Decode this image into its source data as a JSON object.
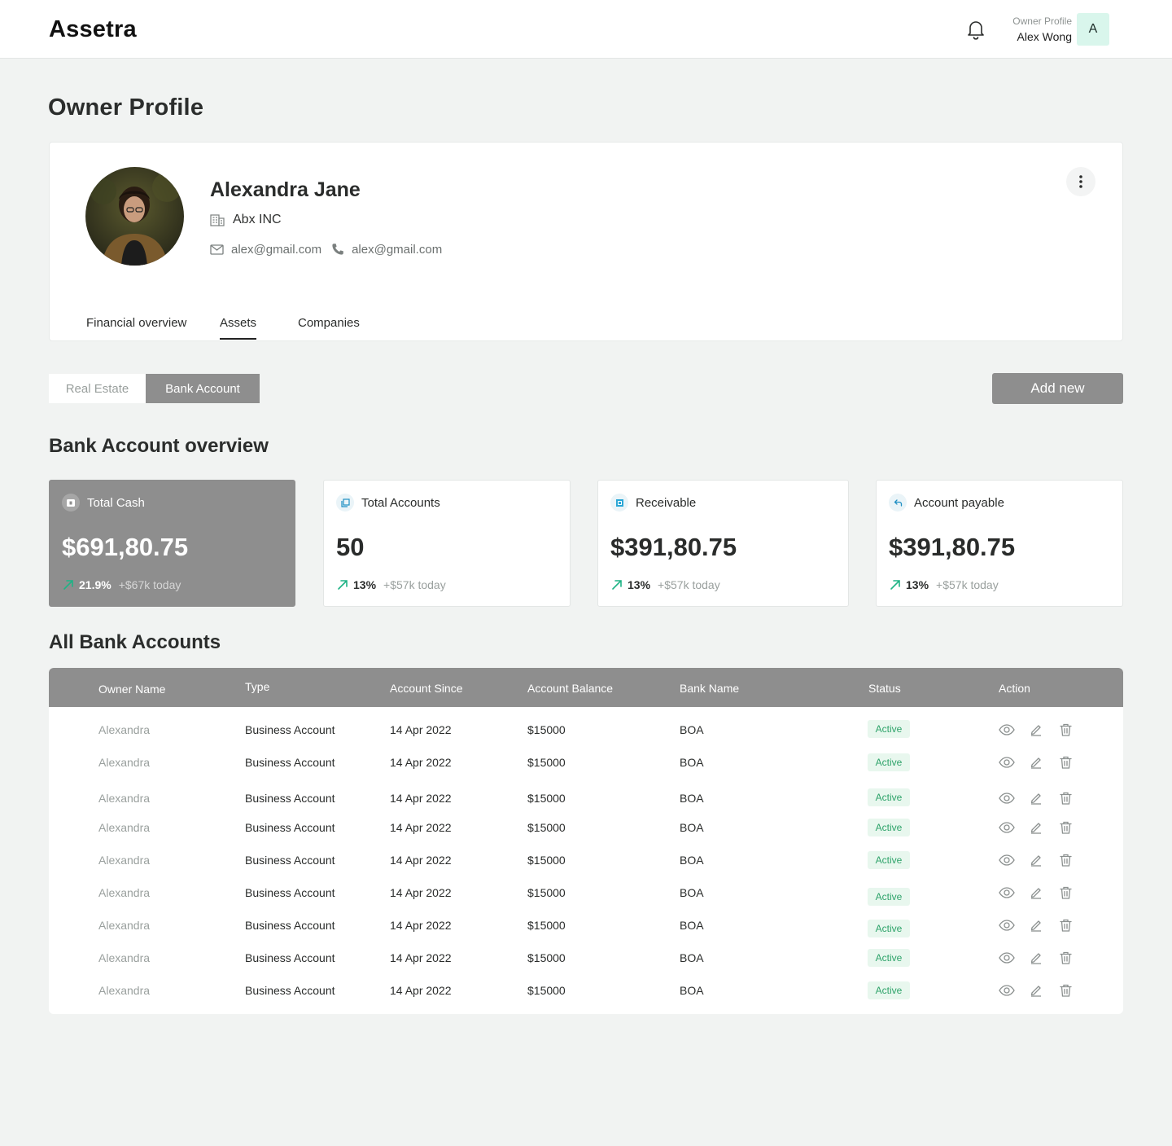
{
  "app": {
    "brand": "Assetra"
  },
  "header": {
    "user_role": "Owner Profile",
    "user_name": "Alex Wong",
    "avatar_initial": "A"
  },
  "page": {
    "title": "Owner Profile"
  },
  "profile": {
    "name": "Alexandra Jane",
    "company": "Abx INC",
    "email": "alex@gmail.com",
    "phone": "alex@gmail.com",
    "tabs": [
      {
        "label": "Financial overview"
      },
      {
        "label": "Assets"
      },
      {
        "label": "Companies"
      }
    ],
    "active_tab": "Assets"
  },
  "asset_switch": {
    "options": [
      "Real Estate",
      "Bank Account"
    ],
    "selected": "Bank Account"
  },
  "add_button": "Add new",
  "overview": {
    "title": "Bank Account overview",
    "cards": [
      {
        "label": "Total Cash",
        "value": "$691,80.75",
        "pct": "21.9%",
        "delta": "+$67k today",
        "icon": "cash-icon"
      },
      {
        "label": "Total Accounts",
        "value": "50",
        "pct": "13%",
        "delta": "+$57k today",
        "icon": "accounts-icon"
      },
      {
        "label": "Receivable",
        "value": "$391,80.75",
        "pct": "13%",
        "delta": "+$57k today",
        "icon": "receivable-icon"
      },
      {
        "label": "Account payable",
        "value": "$391,80.75",
        "pct": "13%",
        "delta": "+$57k today",
        "icon": "payable-icon"
      }
    ]
  },
  "accounts": {
    "title": "All Bank Accounts",
    "columns": [
      "Owner Name",
      "Type",
      "Account Since",
      "Account Balance",
      "Bank Name",
      "Status",
      "Action"
    ],
    "rows": [
      {
        "owner": "Alexandra",
        "type": "Business Account",
        "since": "14 Apr 2022",
        "balance": "$15000",
        "bank": "BOA",
        "status": "Active"
      },
      {
        "owner": "Alexandra",
        "type": "Business Account",
        "since": "14 Apr 2022",
        "balance": "$15000",
        "bank": "BOA",
        "status": "Active"
      },
      {
        "owner": "Alexandra",
        "type": "Business Account",
        "since": "14 Apr 2022",
        "balance": "$15000",
        "bank": "BOA",
        "status": "Active"
      },
      {
        "owner": "Alexandra",
        "type": "Business Account",
        "since": "14 Apr 2022",
        "balance": "$15000",
        "bank": "BOA",
        "status": "Active"
      },
      {
        "owner": "Alexandra",
        "type": "Business Account",
        "since": "14 Apr 2022",
        "balance": "$15000",
        "bank": "BOA",
        "status": "Active"
      },
      {
        "owner": "Alexandra",
        "type": "Business Account",
        "since": "14 Apr 2022",
        "balance": "$15000",
        "bank": "BOA",
        "status": "Active"
      },
      {
        "owner": "Alexandra",
        "type": "Business Account",
        "since": "14 Apr 2022",
        "balance": "$15000",
        "bank": "BOA",
        "status": "Active"
      },
      {
        "owner": "Alexandra",
        "type": "Business Account",
        "since": "14 Apr 2022",
        "balance": "$15000",
        "bank": "BOA",
        "status": "Active"
      },
      {
        "owner": "Alexandra",
        "type": "Business Account",
        "since": "14 Apr 2022",
        "balance": "$15000",
        "bank": "BOA",
        "status": "Active"
      }
    ]
  },
  "colors": {
    "accent_gray": "#8e8e8e",
    "status_green": "#2ea36a",
    "trend_green": "#1fb385",
    "background": "#f1f3f2"
  }
}
